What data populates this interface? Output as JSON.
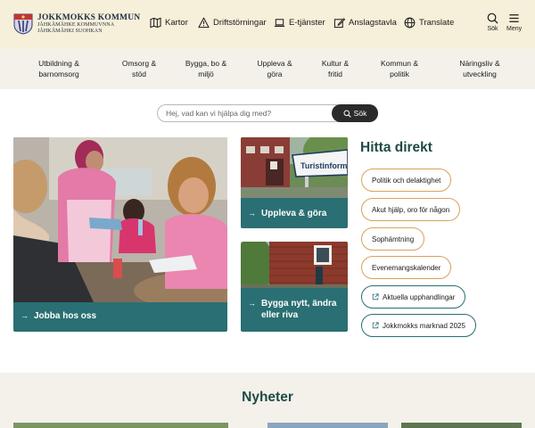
{
  "header": {
    "logo": {
      "main": "JOKKMOKKS KOMMUN",
      "sub1": "JÅHKÅMÅHKE KOMMUVNNA",
      "sub2": "JÅHKÅMÅHKI SUOHKAN"
    },
    "tools": [
      {
        "label": "Kartor",
        "icon": "map-icon"
      },
      {
        "label": "Driftstörningar",
        "icon": "warning-icon"
      },
      {
        "label": "E-tjänster",
        "icon": "laptop-icon"
      },
      {
        "label": "Anslagstavla",
        "icon": "edit-icon"
      },
      {
        "label": "Translate",
        "icon": "globe-icon"
      }
    ],
    "search_label": "Sök",
    "menu_label": "Meny"
  },
  "nav": [
    "Utbildning &\nbarnomsorg",
    "Omsorg &\nstöd",
    "Bygga, bo &\nmiljö",
    "Uppleva &\ngöra",
    "Kultur &\nfritid",
    "Kommun &\npolitik",
    "Näringsliv &\nutveckling"
  ],
  "search": {
    "placeholder": "Hej, vad kan vi hjälpa dig med?",
    "button": "Sök"
  },
  "cards": {
    "jobba": "Jobba hos oss",
    "uppleva": "Uppleva & göra",
    "bygga": "Bygga nytt, ändra eller riva",
    "sign_text": "Turistinformat"
  },
  "hitta": {
    "title": "Hitta direkt",
    "links": [
      {
        "label": "Politik och delaktighet",
        "external": false
      },
      {
        "label": "Akut hjälp, oro för någon",
        "external": false
      },
      {
        "label": "Sophämtning",
        "external": false
      },
      {
        "label": "Evenemangskalender",
        "external": false
      },
      {
        "label": "Aktuella upphandlingar",
        "external": true
      },
      {
        "label": "Jokkmokks marknad 2025",
        "external": true
      }
    ]
  },
  "news": {
    "title": "Nyheter"
  },
  "colors": {
    "header_bg": "#f6efd9",
    "nav_bg": "#f3f1ea",
    "teal": "#2a6f73",
    "orange_border": "#d9a25b",
    "heading": "#1f4a47"
  }
}
